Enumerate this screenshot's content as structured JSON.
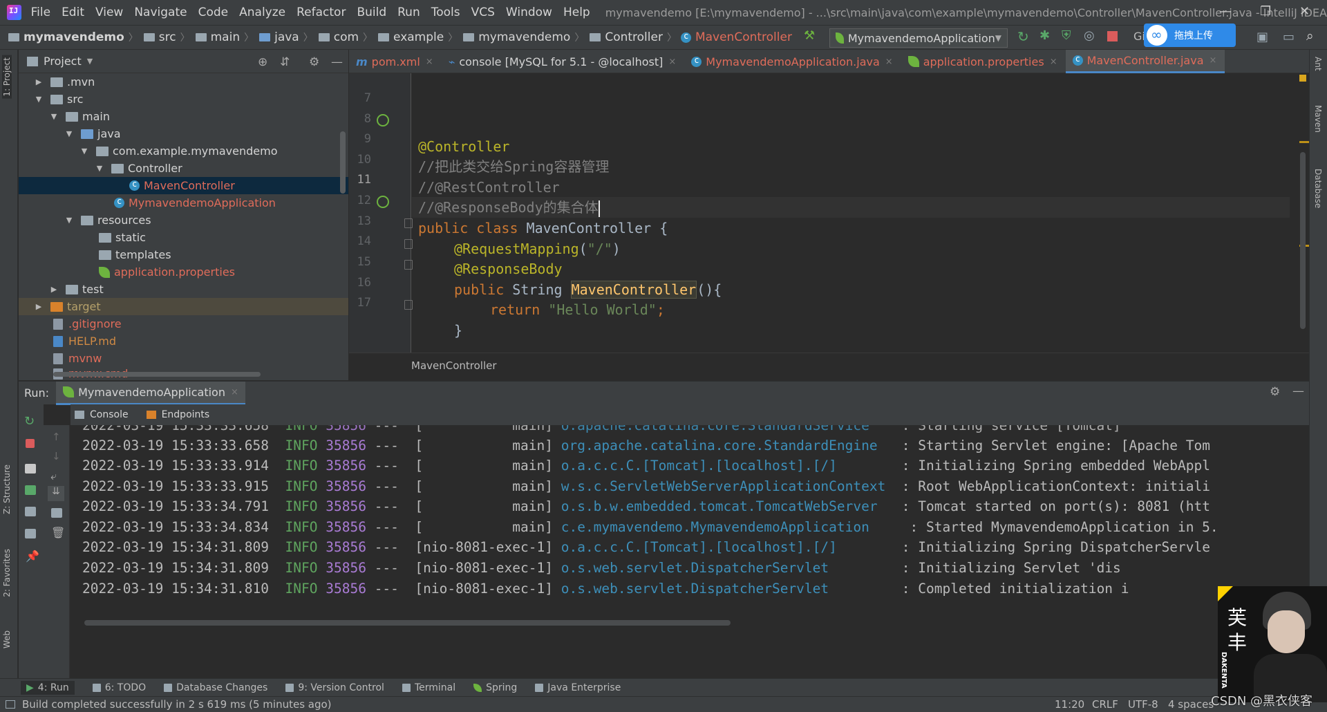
{
  "menubar": {
    "items": [
      "File",
      "Edit",
      "View",
      "Navigate",
      "Code",
      "Analyze",
      "Refactor",
      "Build",
      "Run",
      "Tools",
      "VCS",
      "Window",
      "Help"
    ],
    "window_title": "mymavendemo [E:\\mymavendemo] - ...\\src\\main\\java\\com\\example\\mymavendemo\\Controller\\MavenController.java - IntelliJ IDEA",
    "minimize": "—",
    "restore": "❐",
    "close": "✕"
  },
  "navbar": {
    "crumbs": [
      "mymavendemo",
      "src",
      "main",
      "java",
      "com",
      "example",
      "mymavendemo",
      "Controller",
      "MavenController"
    ],
    "run_config": "MymavendemoApplication",
    "git_label": "Gi",
    "upload_label": "拖拽上传"
  },
  "project": {
    "title": "Project",
    "tree": [
      {
        "label": ".mvn",
        "arrow": "▶"
      },
      {
        "label": "src",
        "arrow": "▼"
      },
      {
        "label": "main",
        "arrow": "▼"
      },
      {
        "label": "java",
        "arrow": "▼"
      },
      {
        "label": "com.example.mymavendemo",
        "arrow": "▼"
      },
      {
        "label": "Controller",
        "arrow": "▼"
      },
      {
        "label": "MavenController",
        "arrow": ""
      },
      {
        "label": "MymavendemoApplication",
        "arrow": ""
      },
      {
        "label": "resources",
        "arrow": "▼"
      },
      {
        "label": "static",
        "arrow": ""
      },
      {
        "label": "templates",
        "arrow": ""
      },
      {
        "label": "application.properties",
        "arrow": ""
      },
      {
        "label": "test",
        "arrow": "▶"
      },
      {
        "label": "target",
        "arrow": "▶"
      },
      {
        "label": ".gitignore",
        "arrow": ""
      },
      {
        "label": "HELP.md",
        "arrow": ""
      },
      {
        "label": "mvnw",
        "arrow": ""
      },
      {
        "label": "mvnw.cmd",
        "arrow": ""
      }
    ]
  },
  "editor": {
    "tabs": [
      "pom.xml",
      "console [MySQL for 5.1 - @localhost]",
      "MymavendemoApplication.java",
      "application.properties",
      "MavenController.java"
    ],
    "tab_close": "×",
    "tab_m_prefix": "m",
    "line_numbers": [
      "7",
      "8",
      "9",
      "10",
      "11",
      "12",
      "13",
      "14",
      "15",
      "16",
      "17"
    ],
    "code": {
      "l8": "@Controller",
      "l9": "//把此类交给Spring容器管理",
      "l10": "//@RestController",
      "l11": "//@ResponseBody的集合体",
      "l12_kw1": "public",
      "l12_kw2": "class",
      "l12_rest": " MavenController {",
      "l13": "@RequestMapping",
      "l13_str": "\"/\"",
      "l13_open": "(",
      "l13_close": ")",
      "l14": "@ResponseBody",
      "l15_kw": "public",
      "l15_type": " String ",
      "l15_name": "MavenController",
      "l15_rest": "(){",
      "l16_kw": "return",
      "l16_str": "\"Hello World\"",
      "l16_semi": ";",
      "l17": "}"
    },
    "footer_crumb": "MavenController"
  },
  "run": {
    "label": "Run:",
    "tab": "MymavendemoApplication",
    "tab_close": "×",
    "subtabs": [
      "Console",
      "Endpoints"
    ],
    "log": [
      {
        "ts": "2022-03-19 15:33:33.658",
        "level": "INFO",
        "pid": "35856",
        "thread": "---  [           main]",
        "logger": "org.apache.catalina.core.StandardEngine ",
        "msg": "  : Starting Servlet engine: [Apache Tom"
      },
      {
        "ts": "2022-03-19 15:33:33.914",
        "level": "INFO",
        "pid": "35856",
        "thread": "---  [           main]",
        "logger": "o.a.c.c.C.[Tomcat].[localhost].[/]      ",
        "msg": "  : Initializing Spring embedded WebAppl"
      },
      {
        "ts": "2022-03-19 15:33:33.915",
        "level": "INFO",
        "pid": "35856",
        "thread": "---  [           main]",
        "logger": "w.s.c.ServletWebServerApplicationContext",
        "msg": "  : Root WebApplicationContext: initiali"
      },
      {
        "ts": "2022-03-19 15:33:34.791",
        "level": "INFO",
        "pid": "35856",
        "thread": "---  [           main]",
        "logger": "o.s.b.w.embedded.tomcat.TomcatWebServer ",
        "msg": "  : Tomcat started on port(s): 8081 (htt"
      },
      {
        "ts": "2022-03-19 15:33:34.834",
        "level": "INFO",
        "pid": "35856",
        "thread": "---  [           main]",
        "logger": "c.e.mymavendemo.MymavendemoApplication   ",
        "msg": "  : Started MymavendemoApplication in 5."
      },
      {
        "ts": "2022-03-19 15:34:31.809",
        "level": "INFO",
        "pid": "35856",
        "thread": "---  [nio-8081-exec-1]",
        "logger": "o.a.c.c.C.[Tomcat].[localhost].[/]      ",
        "msg": "  : Initializing Spring DispatcherServle"
      },
      {
        "ts": "2022-03-19 15:34:31.809",
        "level": "INFO",
        "pid": "35856",
        "thread": "---  [nio-8081-exec-1]",
        "logger": "o.s.web.servlet.DispatcherServlet       ",
        "msg": "  : Initializing Servlet 'dis"
      },
      {
        "ts": "2022-03-19 15:34:31.810",
        "level": "INFO",
        "pid": "35856",
        "thread": "---  [nio-8081-exec-1]",
        "logger": "o.s.web.servlet.DispatcherServlet       ",
        "msg": "  : Completed initialization i"
      }
    ]
  },
  "bottom_tabs": [
    "4: Run",
    "6: TODO",
    "Database Changes",
    "9: Version Control",
    "Terminal",
    "Spring",
    "Java Enterprise"
  ],
  "left_strip": [
    "1: Project",
    "Z: Structure",
    "2: Favorites",
    "Web"
  ],
  "right_strip": [
    "Ant",
    "Maven",
    "Database"
  ],
  "status": {
    "message": "Build completed successfully in 2 s 619 ms (5 minutes ago)",
    "position": "11:20",
    "line_sep": "CRLF",
    "encoding": "UTF-8",
    "indent": "4 spaces"
  },
  "overlay": {
    "avatar_text": "芙\n丰",
    "avatar_vertical": "DAKENTA",
    "watermark": "CSDN @黑衣侠客"
  }
}
